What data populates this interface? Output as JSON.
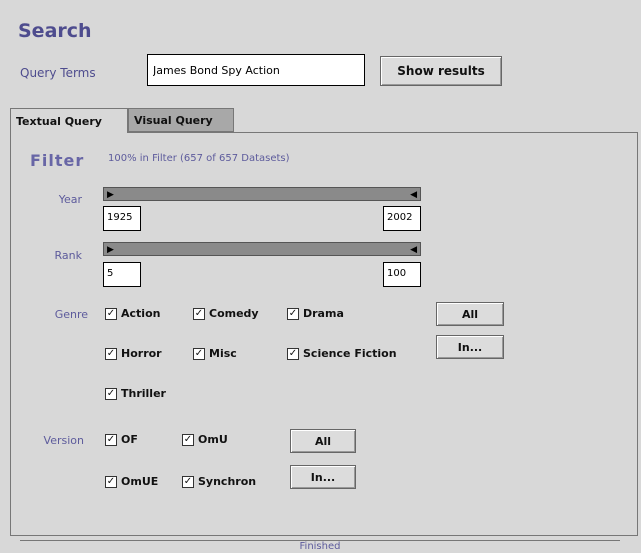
{
  "header": {
    "title": "Search"
  },
  "query": {
    "label": "Query Terms",
    "value": "James Bond Spy Action",
    "show_results": "Show results"
  },
  "tabs": [
    {
      "label": "Textual Query"
    },
    {
      "label": "Visual Query"
    }
  ],
  "filter": {
    "label": "Filter",
    "info": "100% in Filter (657 of 657 Datasets)",
    "year": {
      "label": "Year",
      "min": "1925",
      "max": "2002"
    },
    "rank": {
      "label": "Rank",
      "min": "5",
      "max": "100"
    },
    "genre": {
      "label": "Genre",
      "options": [
        "Action",
        "Comedy",
        "Drama",
        "Horror",
        "Misc",
        "Science Fiction",
        "Thriller"
      ],
      "all": "All",
      "invert": "In..."
    },
    "version": {
      "label": "Version",
      "options": [
        "OF",
        "OmU",
        "OmUE",
        "Synchron"
      ],
      "all": "All",
      "invert": "In..."
    }
  },
  "status": "Finished"
}
